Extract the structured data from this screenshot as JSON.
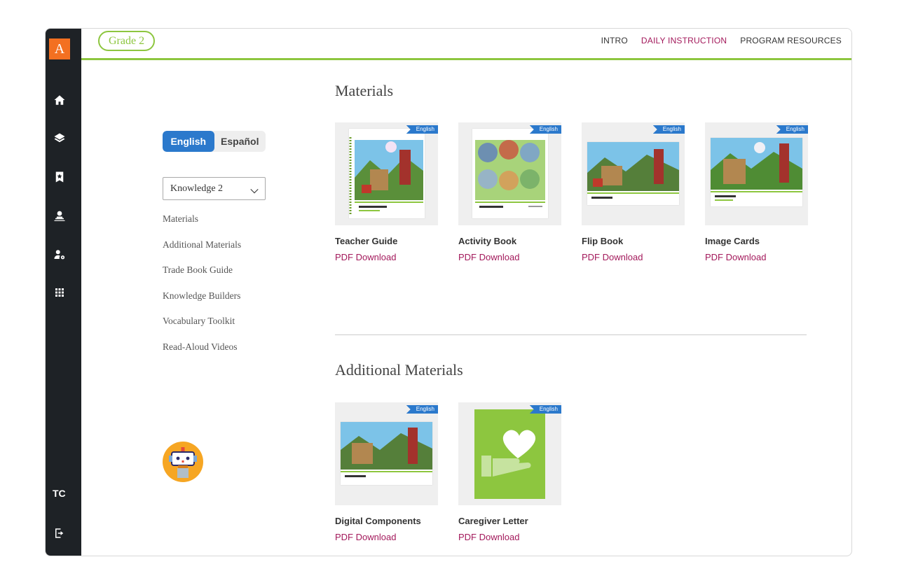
{
  "rail": {
    "logo": "A",
    "user_initials": "TC",
    "icons": [
      "home-icon",
      "layers-icon",
      "bookmark-star-icon",
      "teacher-icon",
      "user-settings-icon",
      "apps-grid-icon",
      "logout-icon"
    ]
  },
  "topbar": {
    "grade": "Grade 2",
    "nav": [
      {
        "label": "INTRO"
      },
      {
        "label": "DAILY INSTRUCTION"
      },
      {
        "label": "PROGRAM RESOURCES"
      }
    ],
    "active_nav": "DAILY INSTRUCTION"
  },
  "sidebar": {
    "languages": [
      "English",
      "Español"
    ],
    "active_language": "English",
    "unit_selected": "Knowledge 2",
    "items": [
      {
        "label": "Materials"
      },
      {
        "label": "Additional Materials"
      },
      {
        "label": "Trade Book Guide"
      },
      {
        "label": "Knowledge Builders"
      },
      {
        "label": "Vocabulary Toolkit"
      },
      {
        "label": "Read-Aloud Videos"
      }
    ]
  },
  "materials": {
    "title": "Materials",
    "cards": [
      {
        "title": "Teacher Guide",
        "link": "PDF Download",
        "badge": "English"
      },
      {
        "title": "Activity Book",
        "link": "PDF Download",
        "badge": "English"
      },
      {
        "title": "Flip Book",
        "link": "PDF Download",
        "badge": "English"
      },
      {
        "title": "Image Cards",
        "link": "PDF Download",
        "badge": "English"
      }
    ]
  },
  "additional": {
    "title": "Additional Materials",
    "cards": [
      {
        "title": "Digital Components",
        "link": "PDF Download",
        "badge": "English"
      },
      {
        "title": "Caregiver Letter",
        "link": "PDF Download",
        "badge": "English"
      }
    ]
  },
  "colors": {
    "accent_green": "#8dc63f",
    "link_magenta": "#a3195b",
    "toggle_blue": "#2b79cc",
    "rail_dark": "#1e2226",
    "logo_orange": "#f37021"
  }
}
